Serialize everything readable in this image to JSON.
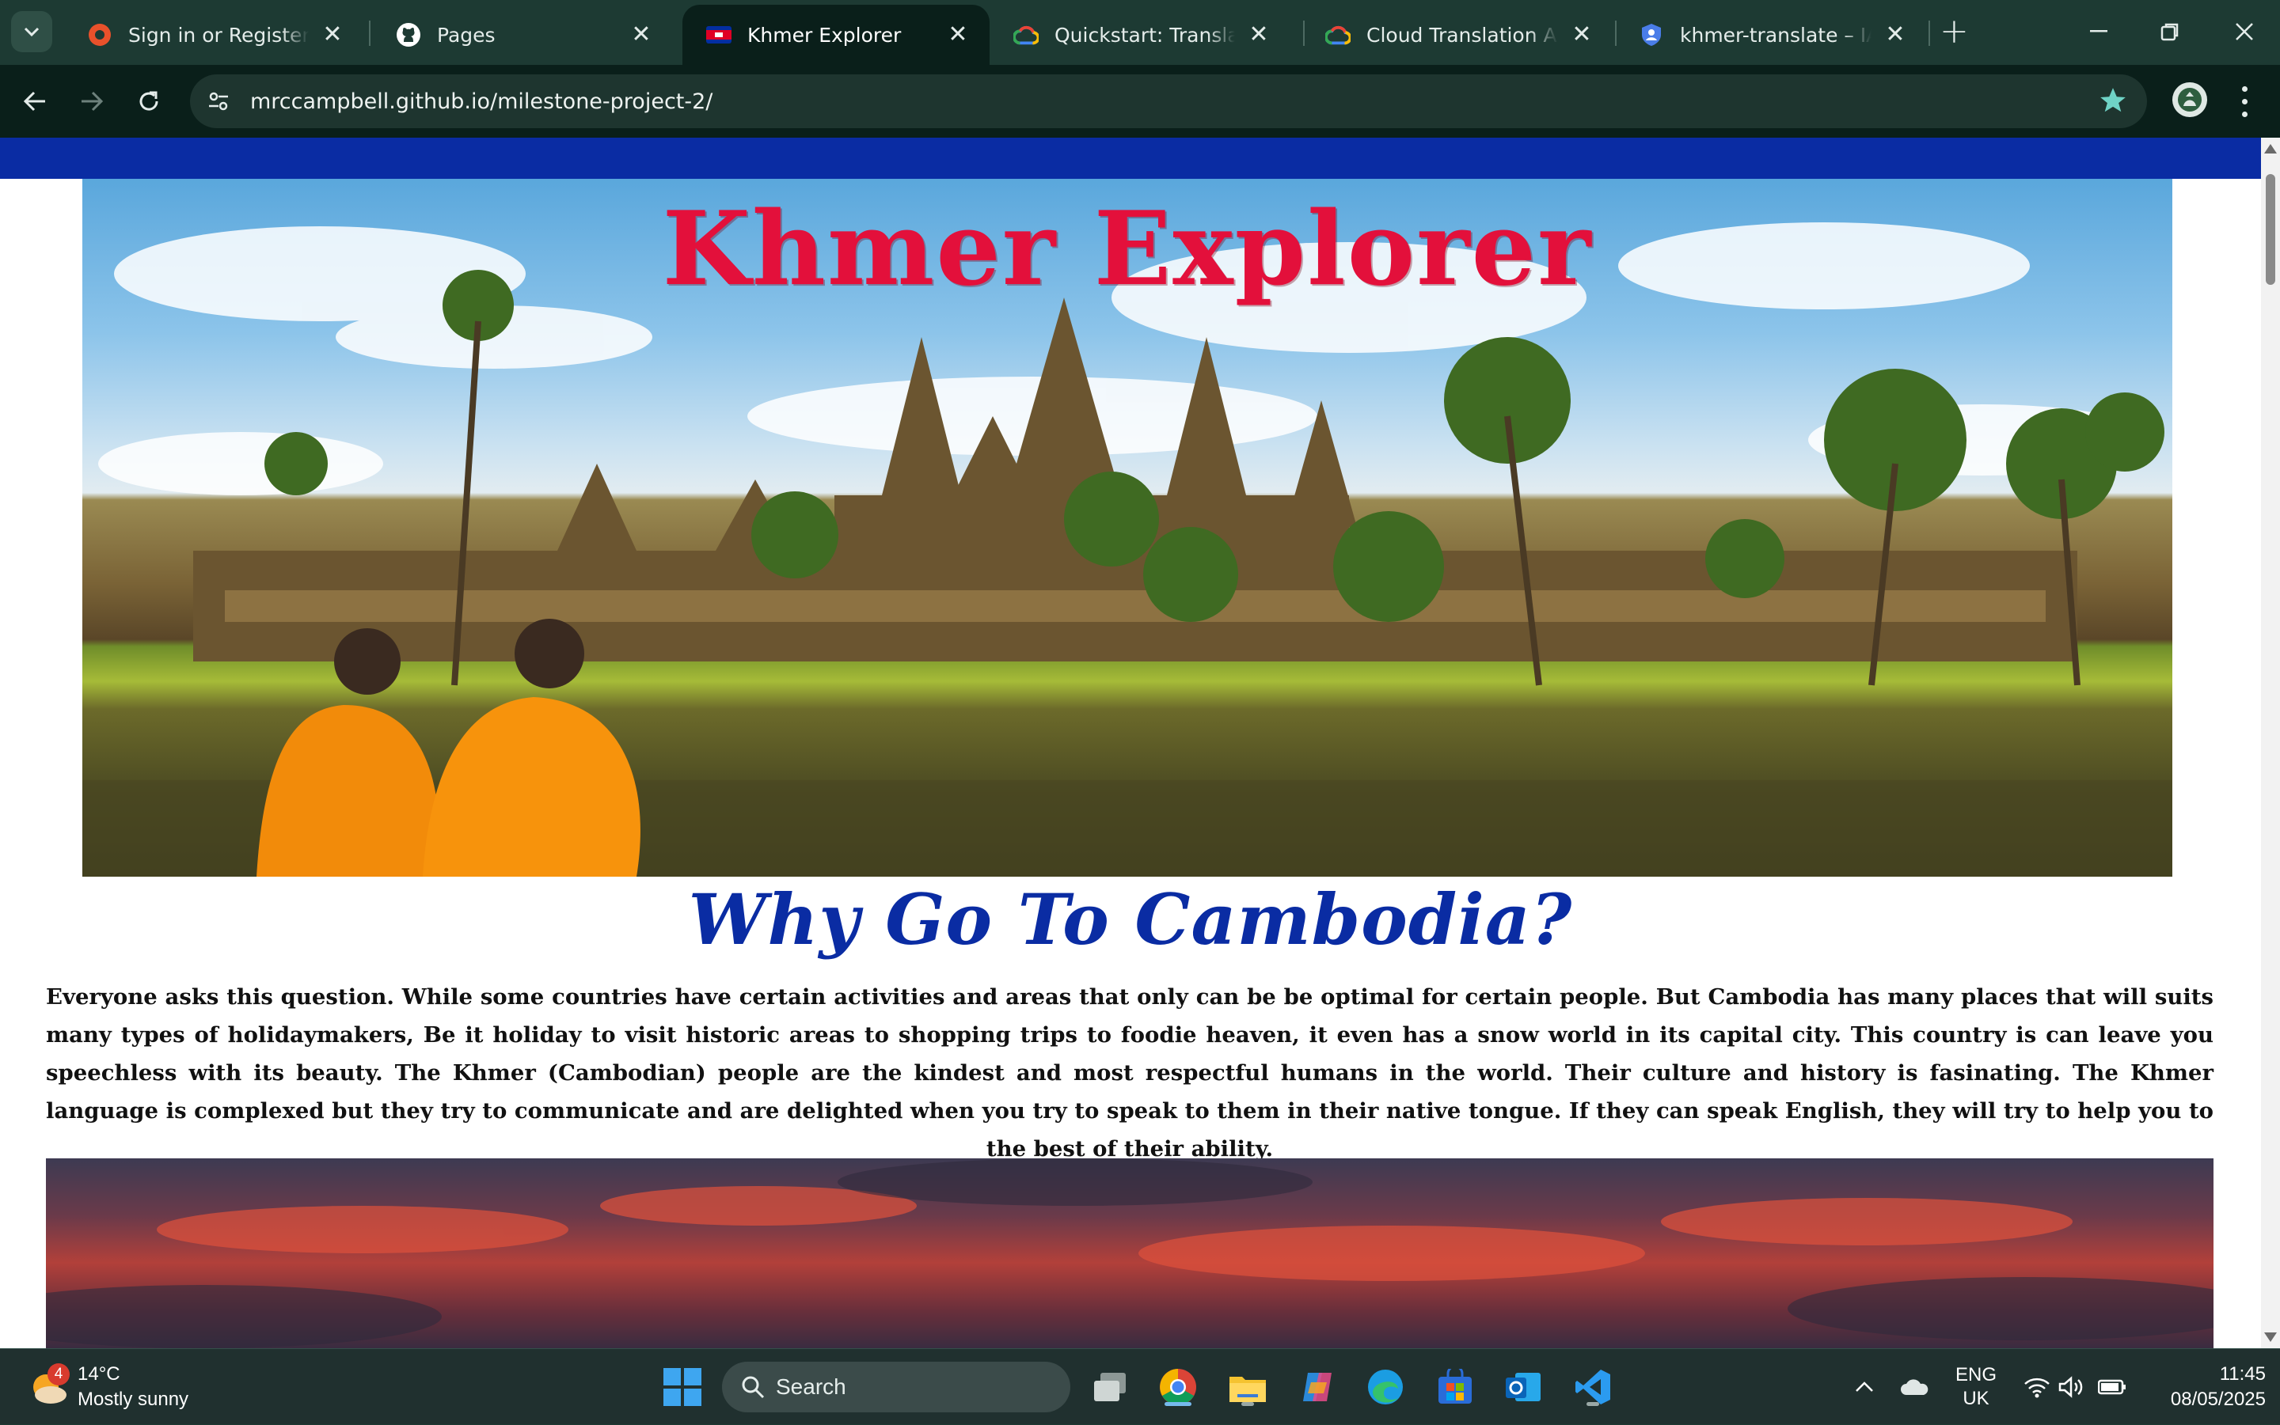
{
  "browser": {
    "tabs": [
      {
        "title": "Sign in or Register | Codecademy",
        "icon": "codeinstitute-icon"
      },
      {
        "title": "Pages",
        "icon": "github-icon"
      },
      {
        "title": "Khmer Explorer",
        "icon": "cambodia-flag-icon",
        "active": true
      },
      {
        "title": "Quickstart: Translate text",
        "icon": "google-cloud-icon"
      },
      {
        "title": "Cloud Translation API | Google Cloud",
        "icon": "google-cloud-icon"
      },
      {
        "title": "khmer-translate – IAM & Admin",
        "icon": "shield-icon"
      }
    ],
    "url": "mrccampbell.github.io/milestone-project-2/"
  },
  "page": {
    "site_title": "Khmer Explorer",
    "section_title": "Why Go To Cambodia?",
    "intro": "Everyone asks this question. While some countries have certain activities and areas that only can be be optimal for certain people. But Cambodia has many places that will suits many types of holidaymakers, Be it holiday to visit historic areas to shopping trips to foodie heaven, it even has a snow world in its capital city. This country is can leave you speechless with its beauty. The Khmer (Cambodian) people are the kindest and most respectful humans in the world. Their culture and history is fasinating. The Khmer language is complexed but they try to communicate and are delighted when you try to speak to them in their native tongue. If they can speak English, they will try to help you to the best of their ability.",
    "colors": {
      "accent_blue": "#0a2ca3",
      "title_red": "#e3103b"
    }
  },
  "taskbar": {
    "weather": {
      "temp": "14°C",
      "condition": "Mostly sunny",
      "badge": "4"
    },
    "search_label": "Search",
    "language": {
      "line1": "ENG",
      "line2": "UK"
    },
    "clock": {
      "time": "11:45",
      "date": "08/05/2025"
    }
  }
}
